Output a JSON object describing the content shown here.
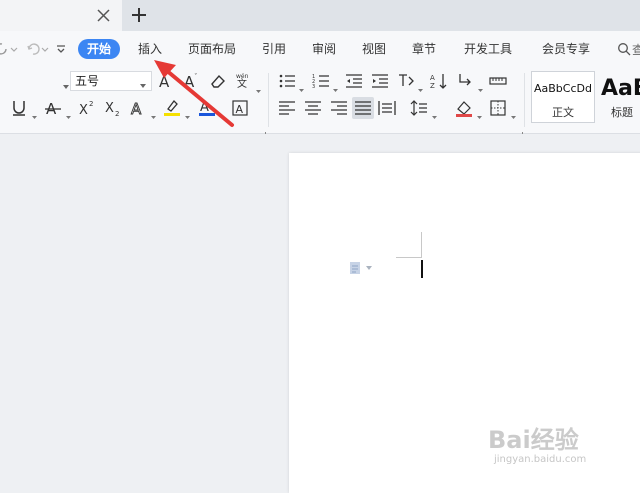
{
  "tabs": {
    "close_icon": "close-icon",
    "new_tab_icon": "plus-icon"
  },
  "menu": {
    "items": [
      {
        "label": "开始",
        "active": true
      },
      {
        "label": "插入"
      },
      {
        "label": "页面布局"
      },
      {
        "label": "引用"
      },
      {
        "label": "审阅"
      },
      {
        "label": "视图"
      },
      {
        "label": "章节"
      },
      {
        "label": "开发工具"
      },
      {
        "label": "会员专享"
      }
    ],
    "search_partial": "查",
    "accent_color": "#3c86f3"
  },
  "ribbon": {
    "font_size": "五号",
    "style_gallery": [
      {
        "sample": "AaBbCcDd",
        "name": "正文"
      },
      {
        "sample": "AaB",
        "name": "标题"
      }
    ],
    "highlight_color": "#f5e000",
    "font_color": "#1a56db"
  },
  "annotation": {
    "arrow_color": "#e53935",
    "points_to": "插入"
  },
  "watermark": {
    "logo": "Bai经验",
    "url": "jingyan.baidu.com"
  }
}
